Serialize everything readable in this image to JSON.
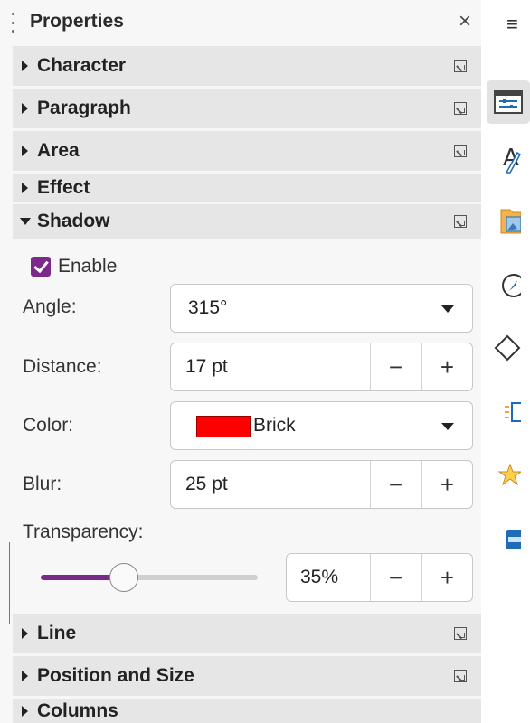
{
  "panel": {
    "title": "Properties",
    "close_glyph": "×"
  },
  "sections": {
    "character": "Character",
    "paragraph": "Paragraph",
    "area": "Area",
    "effect": "Effect",
    "shadow": "Shadow",
    "line": "Line",
    "position_size": "Position and Size",
    "columns": "Columns"
  },
  "shadow": {
    "enable_label": "Enable",
    "enabled": true,
    "angle_label": "Angle:",
    "angle_value": "315°",
    "distance_label": "Distance:",
    "distance_value": "17 pt",
    "color_label": "Color:",
    "color_name": "Brick",
    "color_hex": "#ff0000",
    "blur_label": "Blur:",
    "blur_value": "25 pt",
    "transparency_label": "Transparency:",
    "transparency_value": "35%",
    "transparency_level": 0.35,
    "minus": "−",
    "plus": "+"
  },
  "rail": {
    "menu_glyph": "≡",
    "icons": [
      "properties-icon",
      "styles-icon",
      "gallery-icon",
      "navigator-icon",
      "shapes-icon",
      "animation-icon",
      "slide-transition-icon",
      "master-slides-icon"
    ]
  },
  "colors": {
    "accent": "#7b2a8c",
    "section_bg": "#e6e6e6",
    "panel_bg": "#f7f7f7"
  }
}
